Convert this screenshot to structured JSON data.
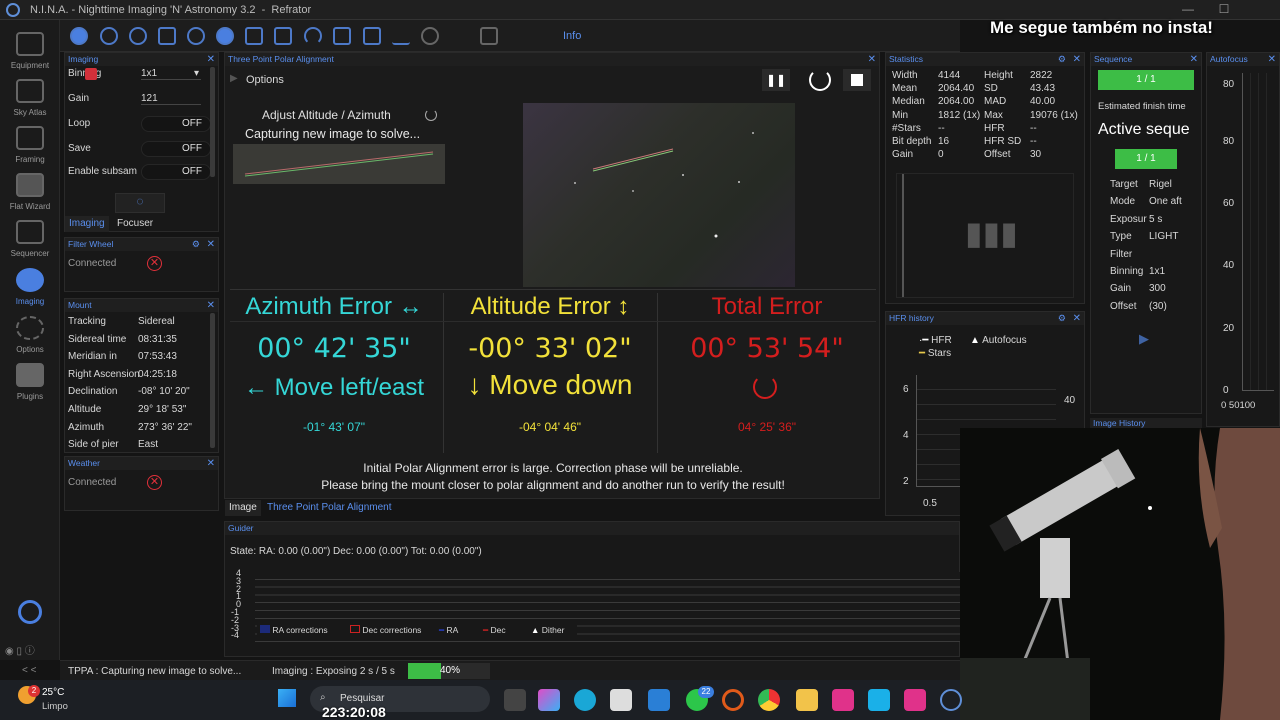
{
  "window": {
    "title": "N.I.N.A. - Nighttime Imaging 'N' Astronomy 3.2",
    "profile": "Refrator",
    "min": "—",
    "max": "☐",
    "close": "✕"
  },
  "overlay_caption": "Me segue também no insta!",
  "nav": [
    {
      "label": "Equipment",
      "icon": "telescope-icon"
    },
    {
      "label": "Sky Atlas",
      "icon": "sky-atlas-icon"
    },
    {
      "label": "Framing",
      "icon": "framing-icon"
    },
    {
      "label": "Flat Wizard",
      "icon": "flat-wizard-icon"
    },
    {
      "label": "Sequencer",
      "icon": "sequencer-icon"
    },
    {
      "label": "Imaging",
      "icon": "imaging-icon"
    },
    {
      "label": "Options",
      "icon": "gear-icon"
    },
    {
      "label": "Plugins",
      "icon": "puzzle-icon"
    }
  ],
  "nav_collapse": "< <",
  "toolbar": {
    "info_label": "Info"
  },
  "imaging_panel": {
    "header": "Imaging",
    "binning_label": "Binning",
    "binning_value": "1x1",
    "gain_label": "Gain",
    "gain_value": "121",
    "loop_label": "Loop",
    "loop_value": "OFF",
    "save_label": "Save",
    "save_value": "OFF",
    "subsample_label": "Enable subsam",
    "subsample_value": "OFF",
    "tabs": [
      "Imaging",
      "Focuser"
    ]
  },
  "filter_wheel": {
    "header": "Filter Wheel",
    "status": "Connected"
  },
  "mount": {
    "header": "Mount",
    "rows": [
      {
        "k": "Tracking",
        "v": "Sidereal"
      },
      {
        "k": "Sidereal time",
        "v": "08:31:35"
      },
      {
        "k": "Meridian in",
        "v": "07:53:43"
      },
      {
        "k": "Right Ascension",
        "v": "04:25:18"
      },
      {
        "k": "Declination",
        "v": "-08° 10' 20\""
      },
      {
        "k": "Altitude",
        "v": "29° 18' 53\""
      },
      {
        "k": "Azimuth",
        "v": "273° 36' 22\""
      },
      {
        "k": "Side of pier",
        "v": "East"
      }
    ]
  },
  "weather": {
    "header": "Weather",
    "status": "Connected"
  },
  "tppa": {
    "header": "Three Point Polar Alignment",
    "options_label": "Options",
    "step_label": "Adjust Altitude / Azimuth",
    "capture_label": "Capturing new image to solve...",
    "azimuth": {
      "title": "Azimuth Error ↔",
      "value": "00° 42' 35\"",
      "move": "← Move left/east",
      "detail": "-01° 43' 07\""
    },
    "altitude": {
      "title": "Altitude Error ↕",
      "value": "-00° 33' 02\"",
      "move": "↓ Move down",
      "detail": "-04° 04' 46\""
    },
    "total": {
      "title": "Total Error",
      "value": "00° 53' 54\"",
      "detail": "04° 25' 36\""
    },
    "message_1": "Initial Polar Alignment error is large. Correction phase will be unreliable.",
    "message_2": "Please bring the mount closer to polar alignment and do another run to verify the result!",
    "tabs": [
      "Image",
      "Three Point Polar Alignment"
    ],
    "colors": {
      "azimuth": "#35d7d7",
      "altitude": "#f2e13a",
      "total": "#d41e1e"
    }
  },
  "statistics": {
    "header": "Statistics",
    "left": [
      {
        "k": "Width",
        "v": "4144"
      },
      {
        "k": "Mean",
        "v": "2064.40"
      },
      {
        "k": "Median",
        "v": "2064.00"
      },
      {
        "k": "Min",
        "v": "1812 (1x)"
      },
      {
        "k": "#Stars",
        "v": "--"
      },
      {
        "k": "Bit depth",
        "v": "16"
      },
      {
        "k": "Gain",
        "v": "0"
      }
    ],
    "right": [
      {
        "k": "Height",
        "v": "2822"
      },
      {
        "k": "SD",
        "v": "43.43"
      },
      {
        "k": "MAD",
        "v": "40.00"
      },
      {
        "k": "Max",
        "v": "19076 (1x)"
      },
      {
        "k": "HFR",
        "v": "--"
      },
      {
        "k": "HFR SD",
        "v": "--"
      },
      {
        "k": "Offset",
        "v": "30"
      }
    ]
  },
  "hfr_history": {
    "header": "HFR history",
    "legend": [
      "HFR",
      "Autofocus",
      "Stars"
    ],
    "y_ticks": [
      "6",
      "4",
      "2"
    ],
    "x_tick": "0.5",
    "right_tick": "40"
  },
  "sequence": {
    "header": "Sequence",
    "progress_1": "1 / 1",
    "finish_label": "Estimated finish time",
    "active_title": "Active seque",
    "progress_2": "1 / 1",
    "rows": [
      {
        "k": "Target",
        "v": "Rigel"
      },
      {
        "k": "Mode",
        "v": "One aft"
      },
      {
        "k": "Exposur",
        "v": "5 s"
      },
      {
        "k": "Type",
        "v": "LIGHT"
      },
      {
        "k": "Filter",
        "v": ""
      },
      {
        "k": "Binning",
        "v": "1x1"
      },
      {
        "k": "Gain",
        "v": "300"
      },
      {
        "k": "Offset",
        "v": "(30)"
      }
    ],
    "image_history": "Image History"
  },
  "autofocus": {
    "header": "Autofocus",
    "y_ticks": [
      "80",
      "60",
      "40",
      "20",
      "0"
    ],
    "x_ticks": "0 50100"
  },
  "guider": {
    "header": "Guider",
    "state": "State:  RA: 0.00 (0.00\")  Dec: 0.00 (0.00\")  Tot: 0.00 (0.00\")",
    "y_ticks": [
      "4",
      "3",
      "2",
      "1",
      "0",
      "-1",
      "-2",
      "-3",
      "-4"
    ],
    "legend": [
      "RA corrections",
      "Dec corrections",
      "RA",
      "Dec",
      "Dither"
    ]
  },
  "status": {
    "tppa": "TPPA :   Capturing new image to solve...",
    "imaging": "Imaging :   Exposing 2 s / 5 s",
    "progress_text": "40%",
    "progress": 0.4
  },
  "taskbar": {
    "weather_temp": "25°C",
    "weather_desc": "Limpo",
    "badge": "2",
    "search": "Pesquisar",
    "clock": "223:20:08",
    "whatsapp_badge": "22"
  }
}
